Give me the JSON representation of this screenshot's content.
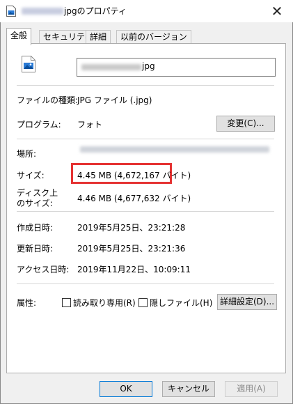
{
  "window": {
    "title": "jpgのプロパティ",
    "close_glyph": "✕"
  },
  "tabs": [
    {
      "label": "全般"
    },
    {
      "label": "セキュリティ"
    },
    {
      "label": "詳細"
    },
    {
      "label": "以前のバージョン"
    }
  ],
  "file": {
    "name_suffix": "jpg"
  },
  "details": {
    "file_type_label": "ファイルの種類:",
    "file_type_value": "JPG ファイル (.jpg)",
    "program_label": "プログラム:",
    "program_value": "フォト",
    "change_button": "変更(C)...",
    "location_label": "場所:",
    "size_label": "サイズ:",
    "size_value": "4.45 MB (4,672,167 バイト)",
    "disk_size_label_line1": "ディスク上",
    "disk_size_label_line2": "のサイズ:",
    "disk_size_value": "4.46 MB (4,677,632 バイト)",
    "created_label": "作成日時:",
    "created_value": "2019年5月25日、23:21:28",
    "modified_label": "更新日時:",
    "modified_value": "2019年5月25日、23:21:36",
    "accessed_label": "アクセス日時:",
    "accessed_value": "2019年11月22日、10:09:11",
    "attributes_label": "属性:",
    "readonly_label": "読み取り専用(R)",
    "hidden_label": "隠しファイル(H)",
    "advanced_button": "詳細設定(D)..."
  },
  "footer": {
    "ok": "OK",
    "cancel": "キャンセル",
    "apply": "適用(A)"
  },
  "colors": {
    "highlight": "#e53333",
    "accent": "#0078d7"
  }
}
